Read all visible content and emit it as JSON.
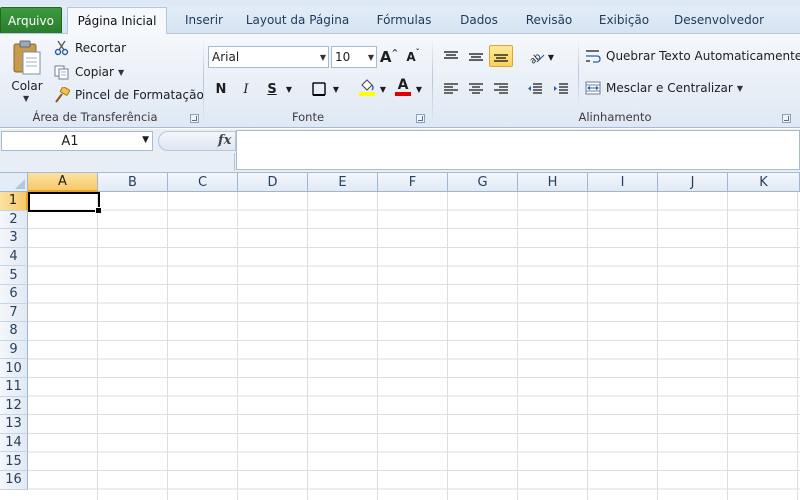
{
  "tabs": {
    "file": "Arquivo",
    "items": [
      "Página Inicial",
      "Inserir",
      "Layout da Página",
      "Fórmulas",
      "Dados",
      "Revisão",
      "Exibição",
      "Desenvolvedor"
    ],
    "active_index": 0
  },
  "clipboard": {
    "paste": "Colar",
    "cut": "Recortar",
    "copy": "Copiar",
    "format_painter": "Pincel de Formatação",
    "group_label": "Área de Transferência"
  },
  "font": {
    "name": "Arial",
    "size": "10",
    "bold": "N",
    "italic": "I",
    "underline": "S",
    "grow": "A",
    "shrink": "A",
    "font_color_letter": "A",
    "group_label": "Fonte",
    "fill_color": "#ffff00",
    "font_color": "#e00000"
  },
  "alignment": {
    "wrap_text": "Quebrar Texto Automaticamente",
    "merge_center": "Mesclar e Centralizar",
    "group_label": "Alinhamento"
  },
  "formula_bar": {
    "name_box": "A1",
    "fx": "fx",
    "value": ""
  },
  "sheet": {
    "columns": [
      "A",
      "B",
      "C",
      "D",
      "E",
      "F",
      "G",
      "H",
      "I",
      "J",
      "K"
    ],
    "rows": [
      "1",
      "2",
      "3",
      "4",
      "5",
      "6",
      "7",
      "8",
      "9",
      "10",
      "11",
      "12",
      "13",
      "14",
      "15",
      "16"
    ],
    "active_cell": "A1",
    "selection_color": "#f7c86a"
  }
}
